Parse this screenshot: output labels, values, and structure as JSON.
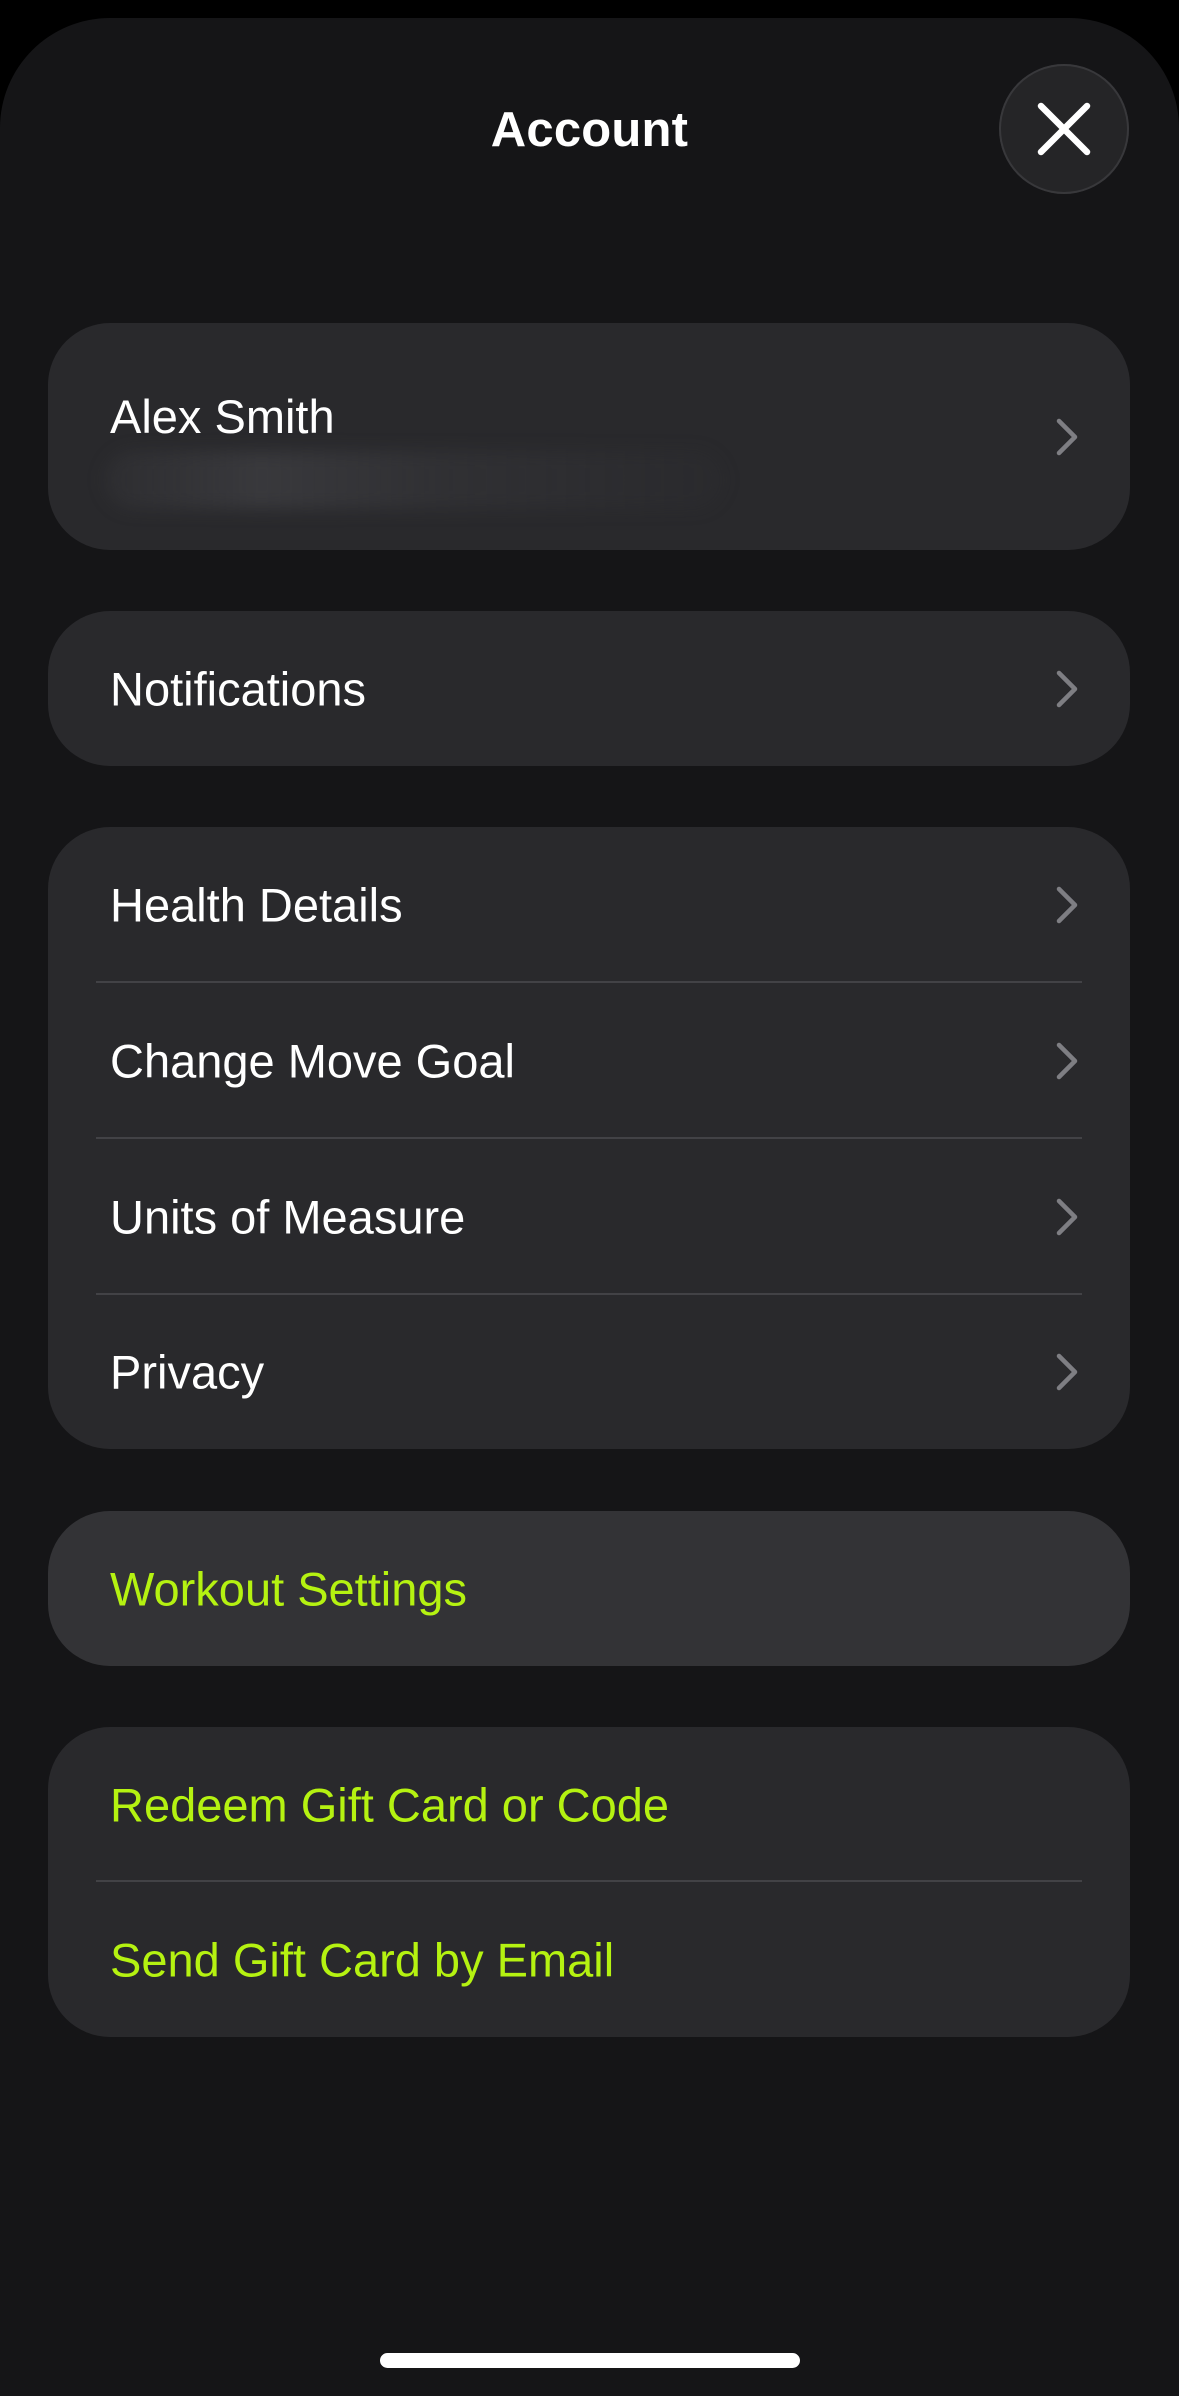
{
  "header": {
    "title": "Account",
    "close_icon": "close-x-icon"
  },
  "profile": {
    "name": "Alex Smith",
    "subtitle_redacted": true
  },
  "notifications": {
    "label": "Notifications"
  },
  "settings_group": {
    "items": [
      {
        "label": "Health Details"
      },
      {
        "label": "Change Move Goal"
      },
      {
        "label": "Units of Measure"
      },
      {
        "label": "Privacy"
      }
    ]
  },
  "workout": {
    "label": "Workout Settings"
  },
  "gift_group": {
    "items": [
      {
        "label": "Redeem Gift Card or Code"
      },
      {
        "label": "Send Gift Card by Email"
      }
    ]
  },
  "colors": {
    "background": "#151517",
    "card": "#29292c",
    "accent": "#b5f211",
    "text": "#ffffff",
    "chevron": "#7e7e83"
  },
  "icons": {
    "row_chevron": "chevron-right-icon"
  }
}
